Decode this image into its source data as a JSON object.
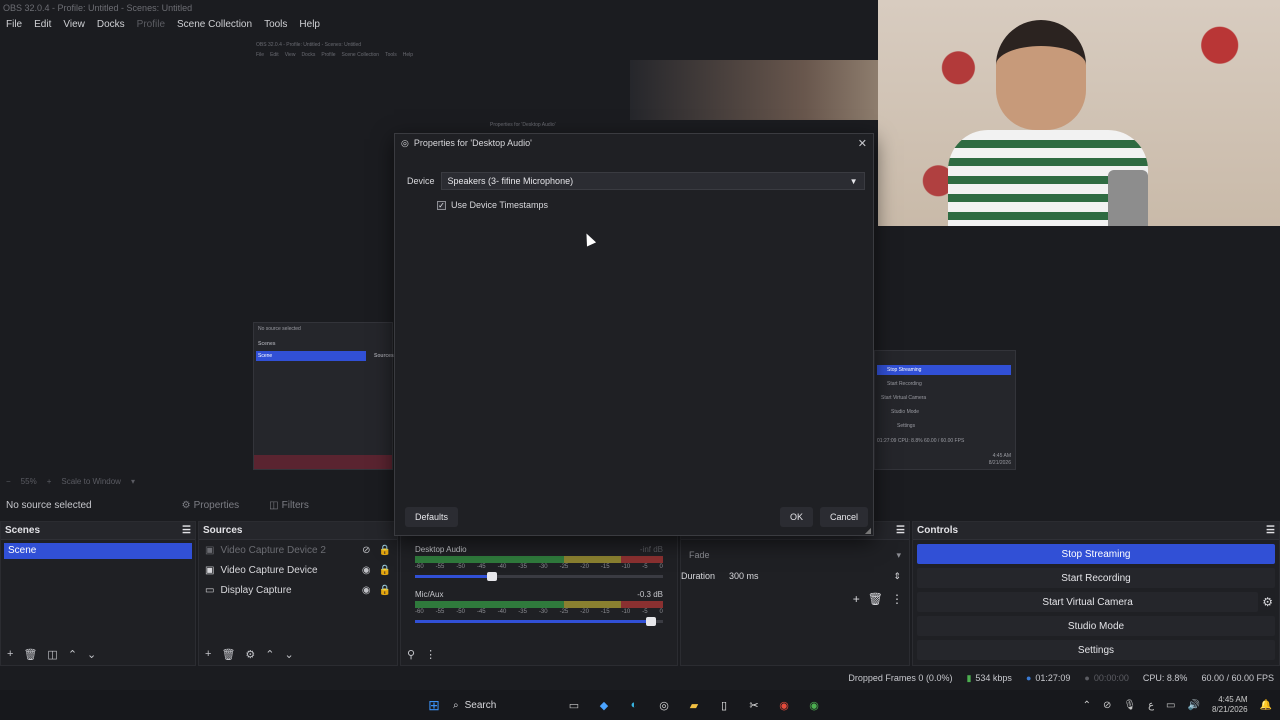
{
  "window": {
    "title": "OBS 32.0.4 - Profile: Untitled - Scenes: Untitled"
  },
  "menu": {
    "items": [
      "File",
      "Edit",
      "View",
      "Docks",
      "Profile",
      "Scene Collection",
      "Tools",
      "Help"
    ]
  },
  "preview": {
    "mini_menu": [
      "File",
      "Edit",
      "View",
      "Docks",
      "Profile",
      "Scene Collection",
      "Tools",
      "Help"
    ],
    "mini_dialog_title": "Properties for 'Desktop Audio'",
    "mini_left": {
      "no_source": "No source selected",
      "scenes": "Scenes",
      "scene": "Scene",
      "sources": "Sources"
    },
    "mini_right": {
      "items": [
        "Stop Streaming",
        "Start Recording",
        "Start Virtual Camera",
        "Studio Mode",
        "Settings"
      ],
      "status": "01:27:09  CPU: 8.8%  60.00 / 60.00 FPS",
      "time": "4:45 AM",
      "date": "8/21/2026"
    }
  },
  "zoombar": {
    "zoom": "55%",
    "scale": "Scale to Window"
  },
  "context": {
    "no_source": "No source selected",
    "properties": "Properties",
    "filters": "Filters"
  },
  "scenes": {
    "title": "Scenes",
    "items": [
      "Scene"
    ]
  },
  "sources": {
    "title": "Sources",
    "items": [
      {
        "label": "Video Capture Device 2",
        "visible": false
      },
      {
        "label": "Video Capture Device",
        "visible": true
      },
      {
        "label": "Display Capture",
        "visible": true
      }
    ]
  },
  "mixer": {
    "channels": [
      {
        "name": "Desktop Audio",
        "db": "-inf dB",
        "volume": 0.33
      },
      {
        "name": "Mic/Aux",
        "db": "-0.3 dB",
        "volume": 0.97
      }
    ],
    "scale": [
      "-60",
      "-55",
      "-50",
      "-45",
      "-40",
      "-35",
      "-30",
      "-25",
      "-20",
      "-15",
      "-10",
      "-5",
      "0"
    ]
  },
  "transitions": {
    "type": "Fade",
    "duration_label": "Duration",
    "duration_value": "300 ms"
  },
  "controls": {
    "title": "Controls",
    "stop_streaming": "Stop Streaming",
    "start_recording": "Start Recording",
    "start_virtual_camera": "Start Virtual Camera",
    "studio_mode": "Studio Mode",
    "settings": "Settings"
  },
  "status": {
    "dropped": "Dropped Frames 0 (0.0%)",
    "bitrate": "534 kbps",
    "stream_time": "01:27:09",
    "rec_time": "00:00:00",
    "cpu": "CPU: 8.8%",
    "fps": "60.00 / 60.00 FPS"
  },
  "dialog": {
    "title": "Properties for 'Desktop Audio'",
    "device_label": "Device",
    "device_value": "Speakers (3- fifine Microphone)",
    "timestamps_label": "Use Device Timestamps",
    "timestamps_checked": true,
    "defaults": "Defaults",
    "ok": "OK",
    "cancel": "Cancel"
  },
  "taskbar": {
    "search": "Search",
    "time": "4:45 AM",
    "date": "8/21/2026"
  },
  "colors": {
    "accent": "#3150d6",
    "background": "#1b1c20",
    "dock": "#1f2024"
  }
}
